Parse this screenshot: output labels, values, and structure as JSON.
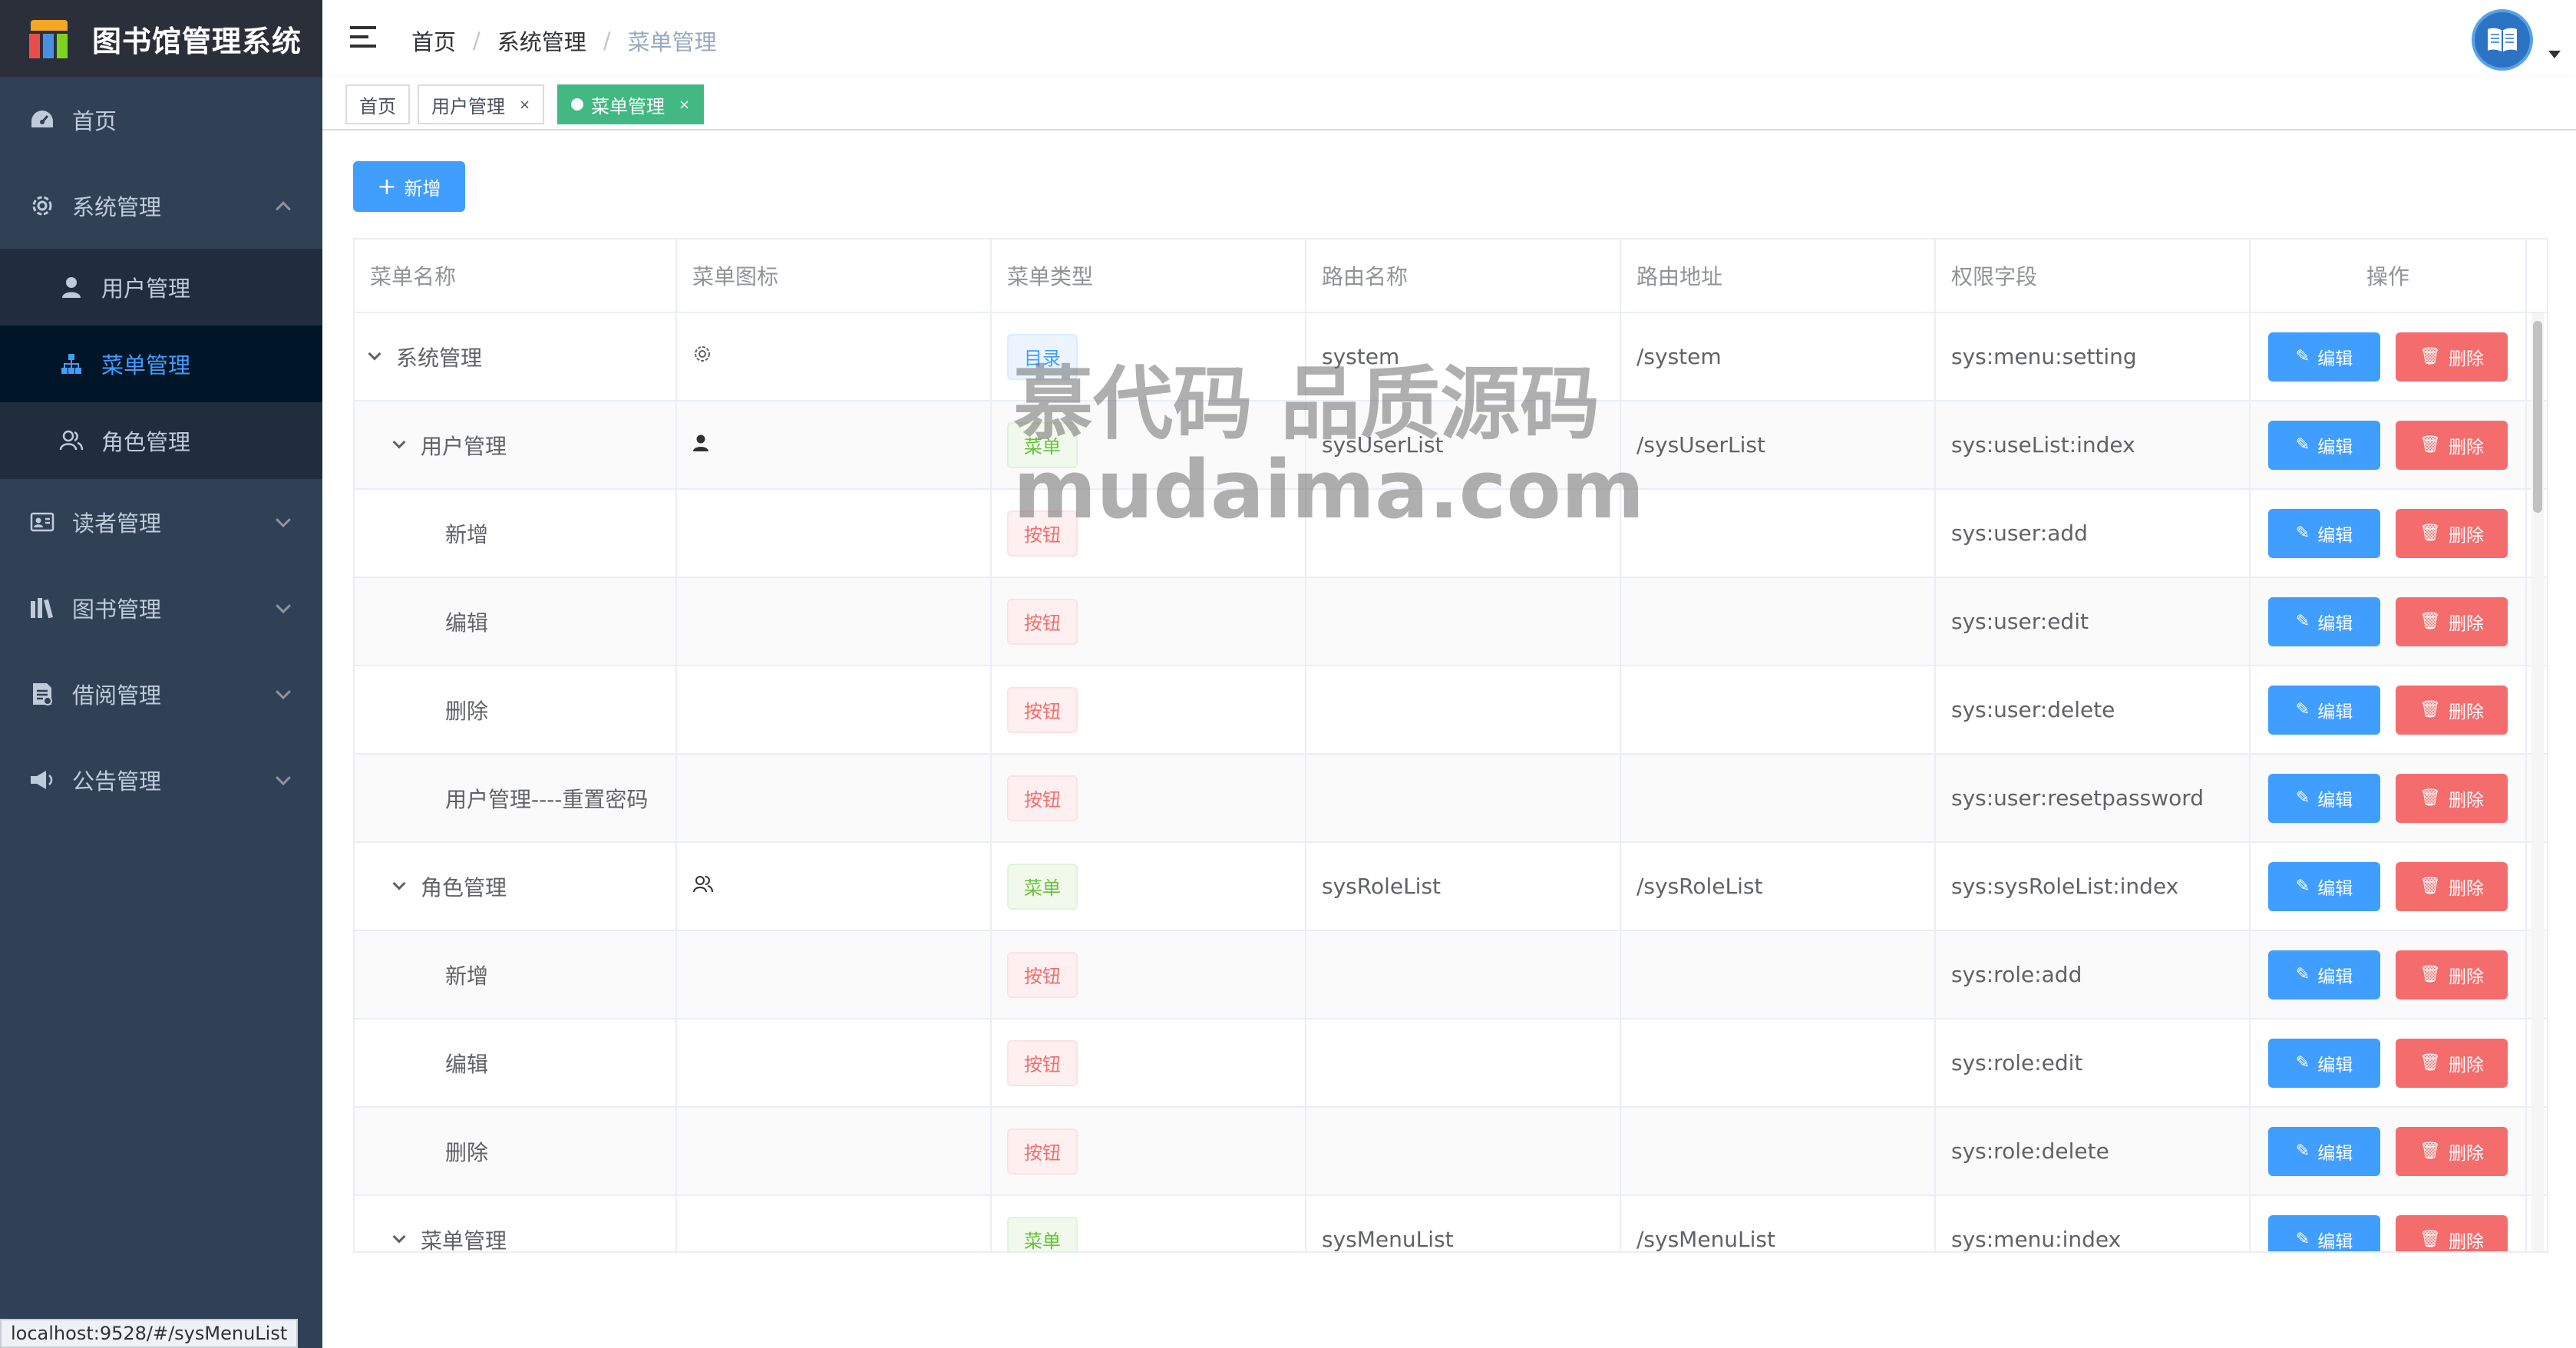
{
  "app": {
    "title": "图书馆管理系统"
  },
  "sidebar": {
    "items": [
      {
        "label": "首页",
        "icon": "dashboard-icon"
      },
      {
        "label": "系统管理",
        "icon": "gear-icon",
        "expanded": true,
        "children": [
          {
            "label": "用户管理",
            "icon": "user-icon"
          },
          {
            "label": "菜单管理",
            "icon": "tree-icon",
            "active": true
          },
          {
            "label": "角色管理",
            "icon": "people-icon"
          }
        ]
      },
      {
        "label": "读者管理",
        "icon": "id-card-icon"
      },
      {
        "label": "图书管理",
        "icon": "books-icon"
      },
      {
        "label": "借阅管理",
        "icon": "document-icon"
      },
      {
        "label": "公告管理",
        "icon": "megaphone-icon"
      }
    ]
  },
  "breadcrumb": [
    "首页",
    "系统管理",
    "菜单管理"
  ],
  "tags": [
    {
      "label": "首页"
    },
    {
      "label": "用户管理",
      "close": "×"
    },
    {
      "label": "菜单管理",
      "close": "×",
      "active": true
    }
  ],
  "toolbar": {
    "add_label": "新增",
    "add_icon": "+"
  },
  "table": {
    "headers": [
      "菜单名称",
      "菜单图标",
      "菜单类型",
      "路由名称",
      "路由地址",
      "权限字段",
      "操作"
    ],
    "edit_label": "编辑",
    "delete_label": "删除",
    "rows": [
      {
        "name": "系统管理",
        "level": 0,
        "expandable": true,
        "icon": "gear-icon",
        "type": "目录",
        "type_kind": "dir",
        "route_name": "system",
        "route_path": "/system",
        "perm": "sys:menu:setting"
      },
      {
        "name": "用户管理",
        "level": 1,
        "expandable": true,
        "icon": "user-icon",
        "type": "菜单",
        "type_kind": "menu",
        "route_name": "sysUserList",
        "route_path": "/sysUserList",
        "perm": "sys:useList:index"
      },
      {
        "name": "新增",
        "level": 2,
        "expandable": false,
        "icon": "",
        "type": "按钮",
        "type_kind": "btn",
        "route_name": "",
        "route_path": "",
        "perm": "sys:user:add"
      },
      {
        "name": "编辑",
        "level": 2,
        "expandable": false,
        "icon": "",
        "type": "按钮",
        "type_kind": "btn",
        "route_name": "",
        "route_path": "",
        "perm": "sys:user:edit"
      },
      {
        "name": "删除",
        "level": 2,
        "expandable": false,
        "icon": "",
        "type": "按钮",
        "type_kind": "btn",
        "route_name": "",
        "route_path": "",
        "perm": "sys:user:delete"
      },
      {
        "name": "用户管理----重置密码",
        "level": 2,
        "expandable": false,
        "icon": "",
        "type": "按钮",
        "type_kind": "btn",
        "route_name": "",
        "route_path": "",
        "perm": "sys:user:resetpassword"
      },
      {
        "name": "角色管理",
        "level": 1,
        "expandable": true,
        "icon": "people-icon",
        "type": "菜单",
        "type_kind": "menu",
        "route_name": "sysRoleList",
        "route_path": "/sysRoleList",
        "perm": "sys:sysRoleList:index"
      },
      {
        "name": "新增",
        "level": 2,
        "expandable": false,
        "icon": "",
        "type": "按钮",
        "type_kind": "btn",
        "route_name": "",
        "route_path": "",
        "perm": "sys:role:add"
      },
      {
        "name": "编辑",
        "level": 2,
        "expandable": false,
        "icon": "",
        "type": "按钮",
        "type_kind": "btn",
        "route_name": "",
        "route_path": "",
        "perm": "sys:role:edit"
      },
      {
        "name": "删除",
        "level": 2,
        "expandable": false,
        "icon": "",
        "type": "按钮",
        "type_kind": "btn",
        "route_name": "",
        "route_path": "",
        "perm": "sys:role:delete"
      },
      {
        "name": "菜单管理",
        "level": 1,
        "expandable": true,
        "icon": "",
        "type": "菜单",
        "type_kind": "menu",
        "route_name": "sysMenuList",
        "route_path": "/sysMenuList",
        "perm": "sys:menu:index"
      }
    ]
  },
  "watermark": {
    "line1": "慕代码 品质源码",
    "line2": "mudaima.com"
  },
  "status_bar": {
    "url": "localhost:9528/#/sysMenuList"
  },
  "colors": {
    "primary": "#409eff",
    "danger": "#f56c6c",
    "success": "#67c23a",
    "sidebar": "#304156",
    "tag_active": "#42b983"
  }
}
